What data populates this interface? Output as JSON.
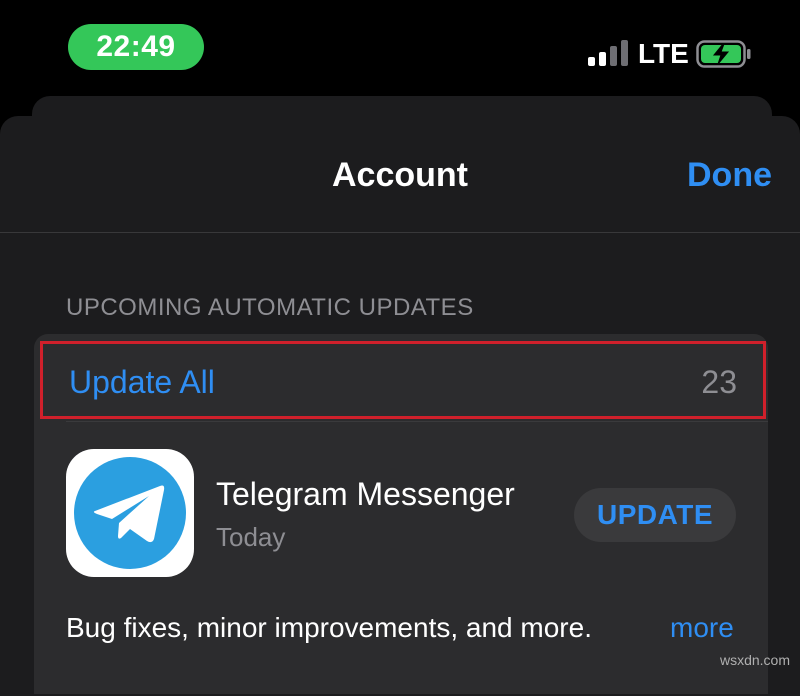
{
  "status_bar": {
    "time": "22:49",
    "network": "LTE",
    "time_pill_color": "#34c759",
    "battery_icon": "battery-charging-icon",
    "signal_icon": "cellular-signal-icon"
  },
  "nav": {
    "title": "Account",
    "done_label": "Done"
  },
  "updates": {
    "section_header": "UPCOMING AUTOMATIC UPDATES",
    "update_all_label": "Update All",
    "update_count": "23",
    "highlight_color": "#d0202b"
  },
  "app": {
    "name": "Telegram Messenger",
    "date": "Today",
    "button_label": "UPDATE",
    "icon": "telegram-logo-icon",
    "release_notes": "Bug fixes, minor improvements, and more.",
    "more_label": "more"
  },
  "colors": {
    "accent": "#2f8ef3",
    "background": "#1c1c1e",
    "secondary_text": "#8e8e93"
  },
  "watermark": "wsxdn.com"
}
